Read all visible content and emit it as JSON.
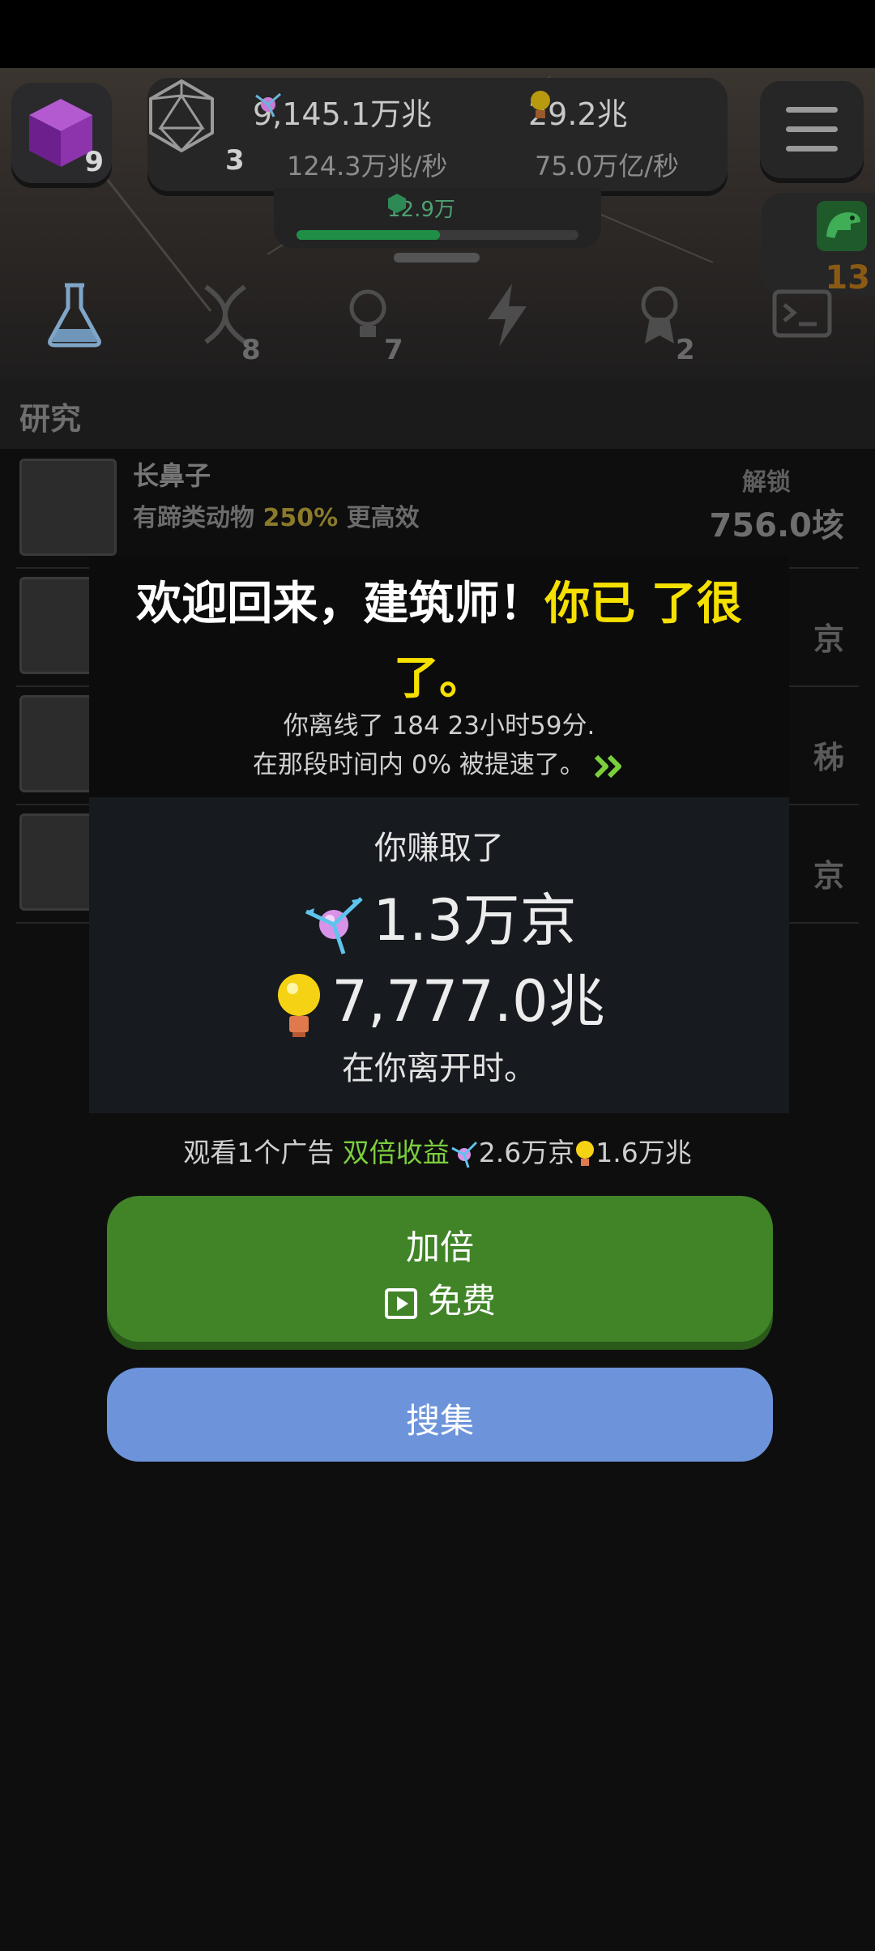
{
  "header": {
    "cube_count": "9",
    "dice_count": "3",
    "resource_a": "9,145.1万兆",
    "resource_a_rate": "124.3万兆/秒",
    "resource_b": "29.2兆",
    "resource_b_rate": "75.0万亿/秒",
    "progress_label": "12.9万",
    "progress_fraction": 0.51,
    "dino_count": "13"
  },
  "tabs": [
    {
      "icon": "flask-icon",
      "count": ""
    },
    {
      "icon": "dna-icon",
      "count": "8"
    },
    {
      "icon": "lightbulb-icon",
      "count": "7"
    },
    {
      "icon": "lightning-icon",
      "count": ""
    },
    {
      "icon": "medal-icon",
      "count": "2"
    },
    {
      "icon": "terminal-icon",
      "count": ""
    }
  ],
  "research": {
    "title": "研究",
    "rows": [
      {
        "name": "长鼻子",
        "desc_pre": "有蹄类动物 ",
        "desc_pct": "250%",
        "desc_post": " 更高效",
        "unlock": "解锁",
        "cost": "756.0垓"
      },
      {
        "tail": "京"
      },
      {
        "tail": "秭"
      },
      {
        "tail": "京"
      }
    ]
  },
  "modal": {
    "welcome_white": "欢迎回来，建筑师！",
    "welcome_yellow": "你已 了很了。",
    "offline_line1": "你离线了 184 23小时59分.",
    "offline_line2": "在那段时间内 0% 被提速了。",
    "earned_header": "你赚取了",
    "earned_a": "1.3万京",
    "earned_b": "7,777.0兆",
    "earned_footer": "在你离开时。",
    "ad_prefix": "观看1个广告 ",
    "ad_highlight": "双倍收益",
    "ad_bonus_a": "2.6万京",
    "ad_bonus_b": "1.6万兆",
    "double_label": "加倍",
    "free_label": "免费",
    "collect_label": "搜集"
  },
  "colors": {
    "accent_yellow": "#f6e000",
    "button_green": "#418428",
    "button_blue": "#6d94da",
    "highlight_green": "#7ccf3c"
  }
}
